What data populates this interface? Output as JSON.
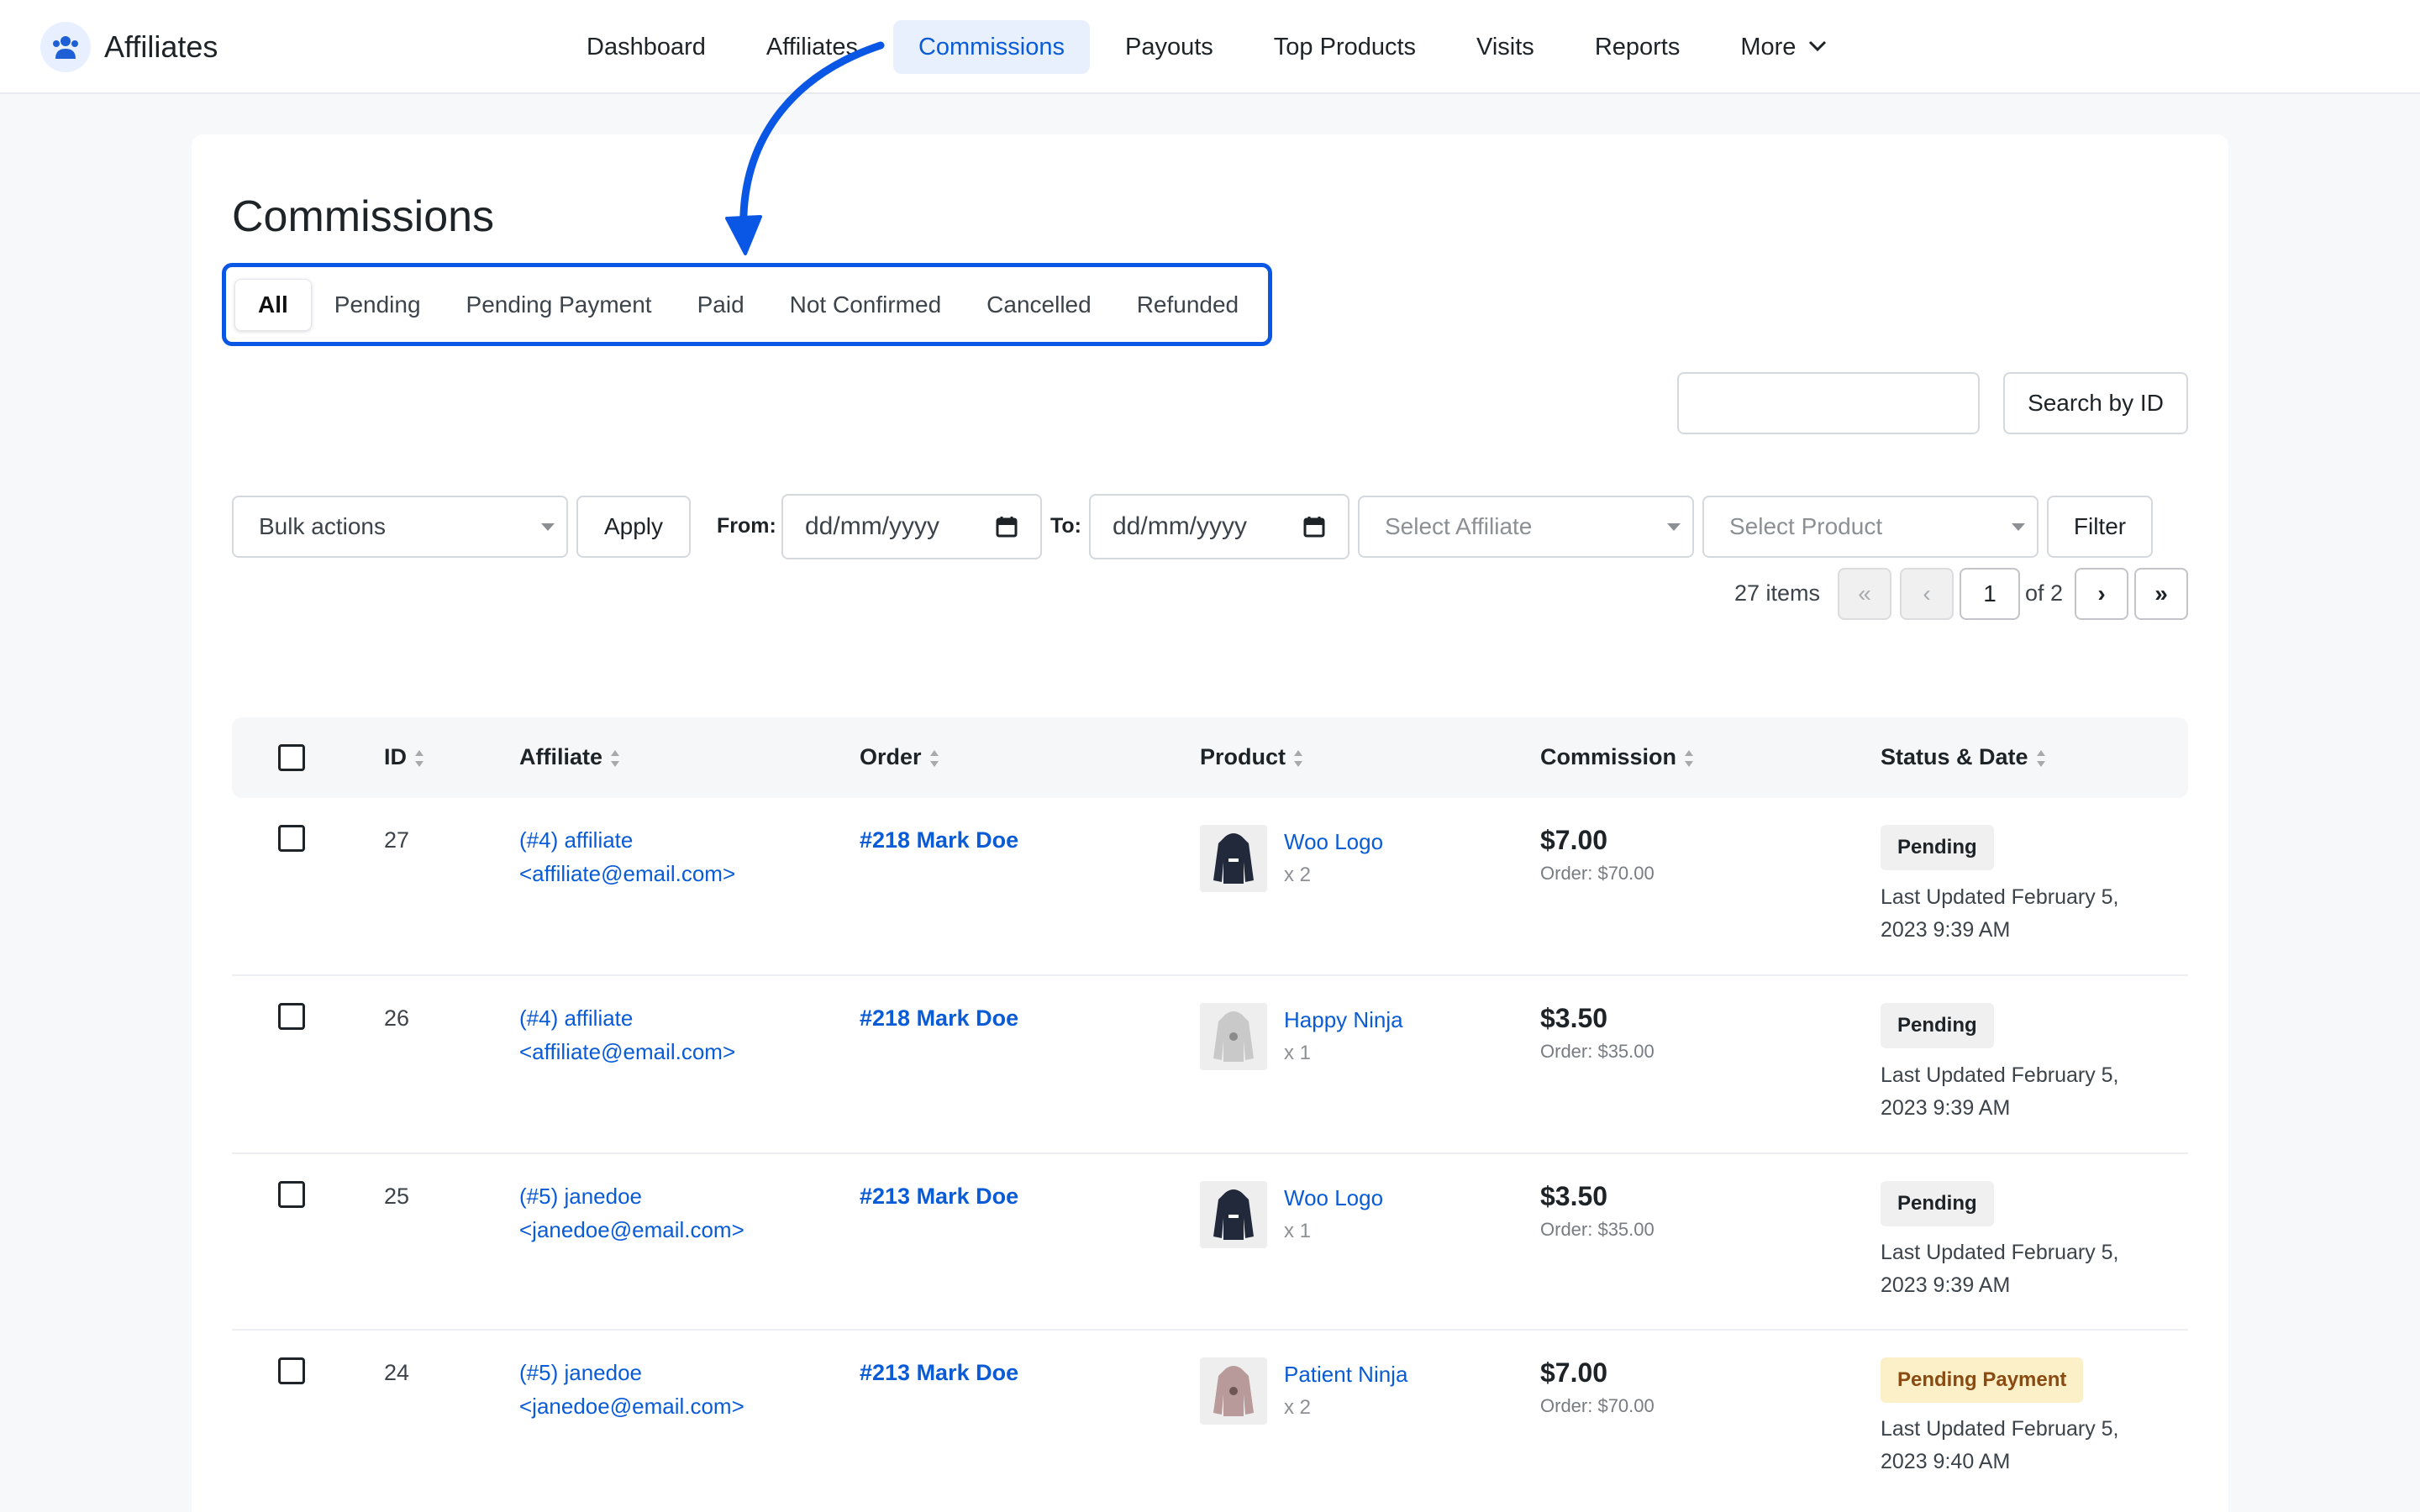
{
  "app": {
    "title": "Affiliates"
  },
  "nav": [
    {
      "label": "Dashboard",
      "active": false
    },
    {
      "label": "Affiliates",
      "active": false
    },
    {
      "label": "Commissions",
      "active": true
    },
    {
      "label": "Payouts",
      "active": false
    },
    {
      "label": "Top Products",
      "active": false
    },
    {
      "label": "Visits",
      "active": false
    },
    {
      "label": "Reports",
      "active": false
    },
    {
      "label": "More",
      "active": false
    }
  ],
  "page": {
    "title": "Commissions"
  },
  "tabs": [
    "All",
    "Pending",
    "Pending Payment",
    "Paid",
    "Not Confirmed",
    "Cancelled",
    "Refunded"
  ],
  "search": {
    "value": "",
    "button": "Search by ID"
  },
  "filters": {
    "bulk": "Bulk actions",
    "apply": "Apply",
    "from_label": "From:",
    "to_label": "To:",
    "from_placeholder": "dd/mm/yyyy",
    "to_placeholder": "dd/mm/yyyy",
    "affiliate": "Select Affiliate",
    "product": "Select Product",
    "filter": "Filter"
  },
  "pagination": {
    "items": "27 items",
    "first": "«",
    "prev": "‹",
    "page": "1",
    "of": "of 2",
    "next": "›",
    "last": "»"
  },
  "table": {
    "headers": [
      "ID",
      "Affiliate",
      "Order",
      "Product",
      "Commission",
      "Status & Date"
    ],
    "rows": [
      {
        "id": "27",
        "affiliate_line1": "(#4) affiliate",
        "affiliate_line2": "<affiliate@email.com>",
        "order": "#218 Mark Doe",
        "product": "Woo Logo",
        "qty": "x 2",
        "amount": "$7.00",
        "order_total": "Order: $70.00",
        "status": "Pending",
        "updated_line1": "Last Updated February 5,",
        "updated_line2": "2023 9:39 AM",
        "thumb": "dark"
      },
      {
        "id": "26",
        "affiliate_line1": "(#4) affiliate",
        "affiliate_line2": "<affiliate@email.com>",
        "order": "#218 Mark Doe",
        "product": "Happy Ninja",
        "qty": "x 1",
        "amount": "$3.50",
        "order_total": "Order: $35.00",
        "status": "Pending",
        "updated_line1": "Last Updated February 5,",
        "updated_line2": "2023 9:39 AM",
        "thumb": "light"
      },
      {
        "id": "25",
        "affiliate_line1": "(#5) janedoe",
        "affiliate_line2": "<janedoe@email.com>",
        "order": "#213 Mark Doe",
        "product": "Woo Logo",
        "qty": "x 1",
        "amount": "$3.50",
        "order_total": "Order: $35.00",
        "status": "Pending",
        "updated_line1": "Last Updated February 5,",
        "updated_line2": "2023 9:39 AM",
        "thumb": "dark"
      },
      {
        "id": "24",
        "affiliate_line1": "(#5) janedoe",
        "affiliate_line2": "<janedoe@email.com>",
        "order": "#213 Mark Doe",
        "product": "Patient Ninja",
        "qty": "x 2",
        "amount": "$7.00",
        "order_total": "Order: $70.00",
        "status": "Pending Payment",
        "updated_line1": "Last Updated February 5,",
        "updated_line2": "2023 9:40 AM",
        "thumb": "pink"
      }
    ]
  },
  "colors": {
    "accent": "#0a5bd6",
    "annotation": "#0a57e6",
    "active_nav_bg": "#e8f0fe",
    "badge_warn_bg": "#fcf0c8"
  }
}
